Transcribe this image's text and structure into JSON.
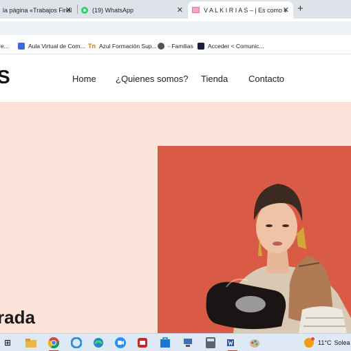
{
  "browser": {
    "tabs": [
      {
        "label": "la página «Trabajos Finale",
        "active": false
      },
      {
        "label": "(19) WhatsApp",
        "active": false
      },
      {
        "label": "V A L K I R I A S – | Es como vos",
        "active": true
      }
    ],
    "close_glyph": "✕",
    "new_tab_glyph": "+",
    "bookmarks": [
      {
        "label": "re...",
        "icon": "bookmark-icon"
      },
      {
        "label": "Aula Virtual de Com...",
        "icon": "puzzle-icon"
      },
      {
        "label": "Azul Formación Sup...",
        "icon": "azul-icon"
      },
      {
        "label": "- Familias",
        "icon": "globe-icon"
      },
      {
        "label": "Acceder < Comunic...",
        "icon": "site-icon"
      }
    ],
    "azul_glyph": "Tn"
  },
  "site": {
    "logo_fragment": "S",
    "nav": {
      "home": "Home",
      "about": "¿Quienes somos?",
      "shop": "Tienda",
      "contact": "Contacto"
    },
    "hero": {
      "heading_fragment": "rada",
      "background_color": "#fde4da",
      "photo_background": "#d95a45"
    }
  },
  "taskbar": {
    "task_view_glyph": "⊞",
    "weather": {
      "temperature": "11°C",
      "condition": "Solea"
    }
  }
}
